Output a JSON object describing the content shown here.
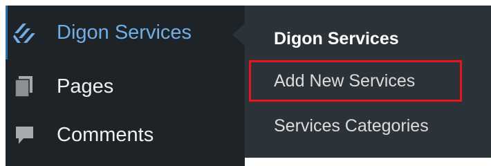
{
  "sidebar": {
    "items": [
      {
        "label": "Digon Services",
        "icon": "digon-logo-icon",
        "current": true
      },
      {
        "label": "Pages",
        "icon": "pages-icon",
        "current": false
      },
      {
        "label": "Comments",
        "icon": "comment-icon",
        "current": false
      }
    ]
  },
  "submenu": {
    "items": [
      {
        "label": "Digon Services",
        "current": true
      },
      {
        "label": "Add New Services",
        "current": false,
        "highlighted": true
      },
      {
        "label": "Services Categories",
        "current": false
      }
    ]
  },
  "colors": {
    "sidebar_bg": "#1d2327",
    "submenu_bg": "#2c3338",
    "accent": "#72aee6",
    "active_bar": "#2271b1",
    "highlight": "#e8141c"
  }
}
